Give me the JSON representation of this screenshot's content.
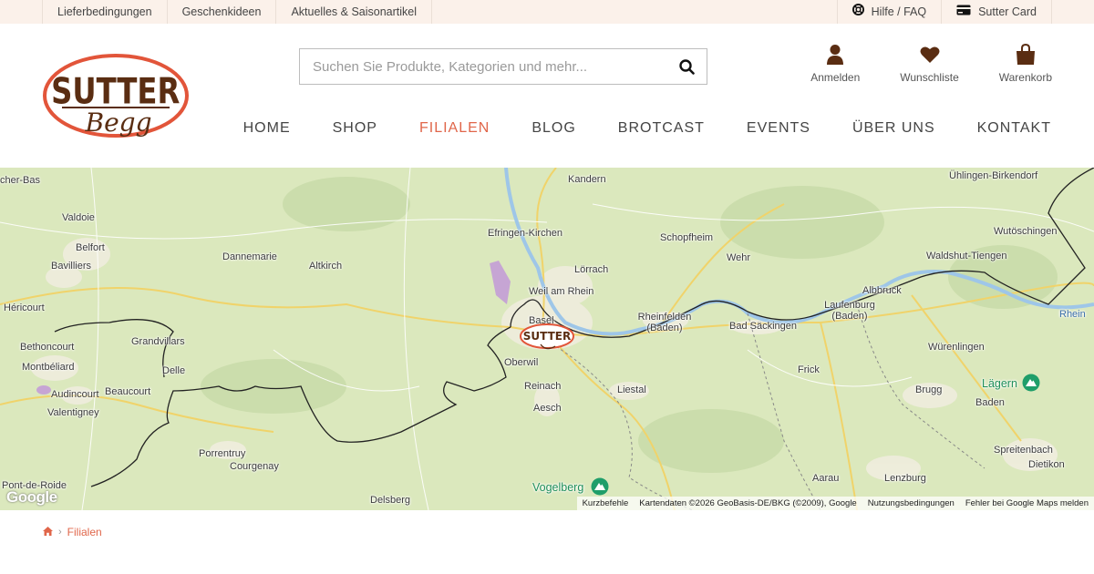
{
  "topbar": {
    "left_links": [
      "Lieferbedingungen",
      "Geschenkideen",
      "Aktuelles & Saisonartikel"
    ],
    "help_label": "Hilfe / FAQ",
    "card_label": "Sutter Card"
  },
  "logo": {
    "wordmark": "SUTTER",
    "script": "Begg"
  },
  "search": {
    "placeholder": "Suchen Sie Produkte, Kategorien und mehr..."
  },
  "header_icons": {
    "login": "Anmelden",
    "wishlist": "Wunschliste",
    "cart": "Warenkorb"
  },
  "nav": {
    "items": [
      "HOME",
      "SHOP",
      "FILIALEN",
      "BLOG",
      "BROTCAST",
      "EVENTS",
      "ÜBER UNS",
      "KONTAKT"
    ],
    "active": "FILIALEN"
  },
  "map": {
    "places": [
      "cher-Bas",
      "Valdoie",
      "Belfort",
      "Bavilliers",
      "Héricourt",
      "Bethoncourt",
      "Montbéliard",
      "Audincourt",
      "Valentigney",
      "Grandvillars",
      "Delle",
      "Beaucourt",
      "Porrentruy",
      "Courgenay",
      "Pont-de-Roide",
      "Delsberg",
      "Dannemarie",
      "Altkirch",
      "Kandern",
      "Efringen-Kirchen",
      "Schopfheim",
      "Lörrach",
      "Weil am Rhein",
      "Basel",
      "Oberwil",
      "Reinach",
      "Aesch",
      "Liestal",
      "Wehr",
      "Rheinfelden (Baden)",
      "Bad Säckingen",
      "Frick",
      "Laufenburg (Baden)",
      "Albbruck",
      "Waldshut-Tiengen",
      "Wutöschingen",
      "Ühlingen-Birkendorf",
      "Würenlingen",
      "Brugg",
      "Baden",
      "Spreitenbach",
      "Dietikon",
      "Aarau",
      "Lenzburg",
      "Rhein"
    ],
    "parks": [
      "Lägern",
      "Vogelberg"
    ],
    "marker_label": "SUTTER",
    "google": "Google",
    "attribution": [
      "Kurzbefehle",
      "Kartendaten ©2026 GeoBasis-DE/BKG (©2009), Google",
      "Nutzungsbedingungen",
      "Fehler bei Google Maps melden"
    ]
  },
  "breadcrumb": {
    "current": "Filialen"
  },
  "colors": {
    "accent": "#e0664a",
    "brown": "#5a2d12",
    "topbar": "#fbf1ea"
  }
}
